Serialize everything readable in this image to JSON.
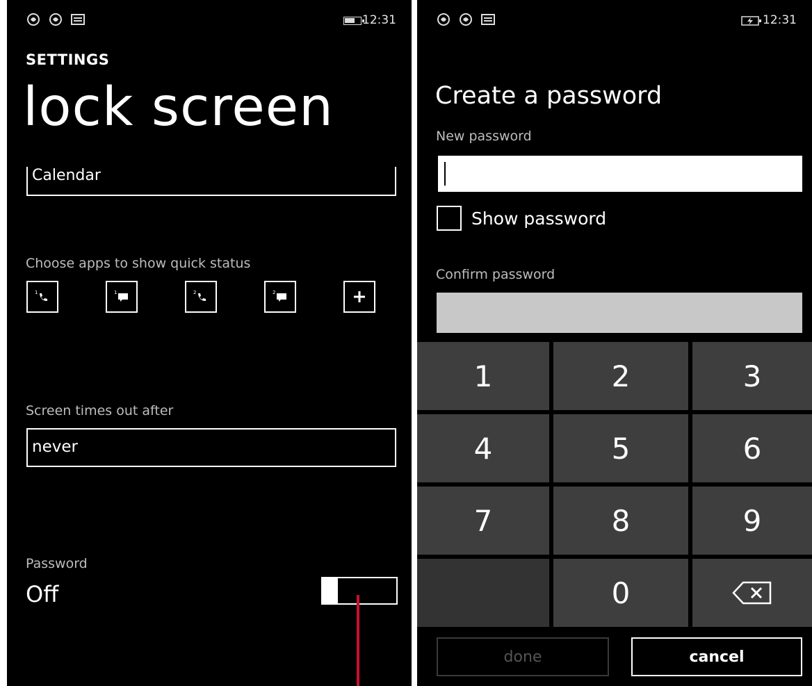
{
  "left": {
    "status": {
      "time": "12:31"
    },
    "settings_caption": "SETTINGS",
    "page_title": "lock screen",
    "calendar_value": "Calendar",
    "quick_status_label": "Choose apps to show quick status",
    "quick_status_apps": [
      {
        "icon": "phone-1-icon",
        "badge": "1"
      },
      {
        "icon": "message-1-icon",
        "badge": "1"
      },
      {
        "icon": "phone-2-icon",
        "badge": "2"
      },
      {
        "icon": "message-2-icon",
        "badge": "2"
      },
      {
        "icon": "plus-icon",
        "badge": ""
      }
    ],
    "timeout_label": "Screen times out after",
    "timeout_value": "never",
    "password_label": "Password",
    "password_value": "Off",
    "pointer_color": "#c8102e"
  },
  "right": {
    "status": {
      "time": "12:31"
    },
    "title": "Create a password",
    "new_password_label": "New password",
    "new_password_value": "",
    "show_password_label": "Show password",
    "show_password_checked": false,
    "confirm_password_label": "Confirm password",
    "confirm_password_value": "",
    "keys": [
      "1",
      "2",
      "3",
      "4",
      "5",
      "6",
      "7",
      "8",
      "9",
      "",
      "0",
      "backspace"
    ],
    "done_label": "done",
    "cancel_label": "cancel"
  }
}
